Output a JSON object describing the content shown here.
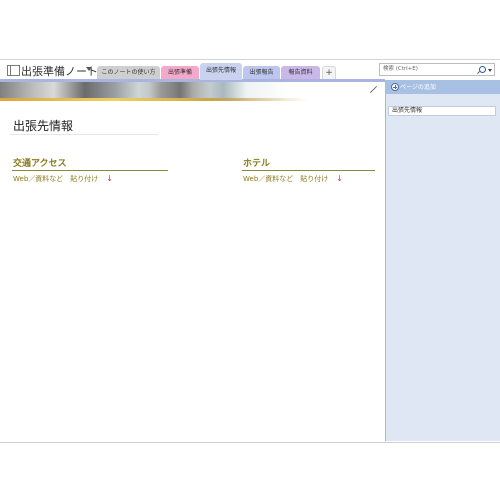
{
  "notebook": {
    "title": "出張準備ノート"
  },
  "tabs": [
    {
      "label": "このノートの使い方",
      "color": "#cfcfcf"
    },
    {
      "label": "出張準備",
      "color": "#f3a9c9"
    },
    {
      "label": "出張先情報",
      "color": "#c9d3f0"
    },
    {
      "label": "出張報告",
      "color": "#bcc6ef"
    },
    {
      "label": "報告資料",
      "color": "#c9b8e8"
    }
  ],
  "add_tab_label": "+",
  "search": {
    "placeholder": "検索 (Ctrl+E)"
  },
  "page": {
    "title": "出張先情報",
    "sections": [
      {
        "heading": "交通アクセス",
        "line": "Web／資料など　貼り付け"
      },
      {
        "heading": "ホテル",
        "line": "Web／資料など　貼り付け"
      }
    ],
    "arrow_glyph": "↓"
  },
  "page_list": {
    "add_label": "ページの追加",
    "items": [
      "出張先情報"
    ]
  },
  "colors": {
    "accent": "#8a7b1e",
    "arrow": "#d23b3b",
    "pane": "#dfe7f4",
    "pane_header": "#a8c0e4"
  }
}
